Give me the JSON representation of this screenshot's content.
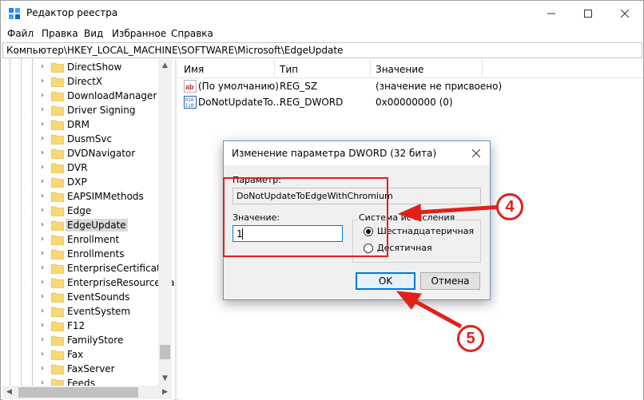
{
  "window": {
    "title": "Редактор реестра",
    "icon": "regedit-icon"
  },
  "menu": [
    "Файл",
    "Правка",
    "Вид",
    "Избранное",
    "Справка"
  ],
  "address": "Компьютер\\HKEY_LOCAL_MACHINE\\SOFTWARE\\Microsoft\\EdgeUpdate",
  "tree": {
    "selected": "EdgeUpdate",
    "items": [
      "DirectShow",
      "DirectX",
      "DownloadManager",
      "Driver Signing",
      "DRM",
      "DusmSvc",
      "DVDNavigator",
      "DVR",
      "DXP",
      "EAPSIMMethods",
      "Edge",
      "EdgeUpdate",
      "Enrollment",
      "Enrollments",
      "EnterpriseCertificates",
      "EnterpriseResourceMa",
      "EventSounds",
      "EventSystem",
      "F12",
      "FamilyStore",
      "Fax",
      "FaxServer",
      "Feeds"
    ]
  },
  "list": {
    "columns": [
      "Имя",
      "Тип",
      "Значение"
    ],
    "rows": [
      {
        "name": "(По умолчанию)",
        "type": "REG_SZ",
        "value": "(значение не присвоено)",
        "icon": "string-value-icon"
      },
      {
        "name": "DoNotUpdateTo...",
        "type": "REG_DWORD",
        "value": "0x00000000 (0)",
        "icon": "binary-value-icon"
      }
    ]
  },
  "dialog": {
    "title": "Изменение параметра DWORD (32 бита)",
    "param_label": "Параметр:",
    "param_value": "DoNotUpdateToEdgeWithChromium",
    "value_label": "Значение:",
    "value": "1",
    "base_label": "Система исчисления",
    "hex_label": "Шестнадцатеричная",
    "dec_label": "Десятичная",
    "base_selected": "hex",
    "ok": "OK",
    "cancel": "Отмена"
  },
  "annotations": {
    "step4": "4",
    "step5": "5",
    "color": "#e0201b"
  }
}
